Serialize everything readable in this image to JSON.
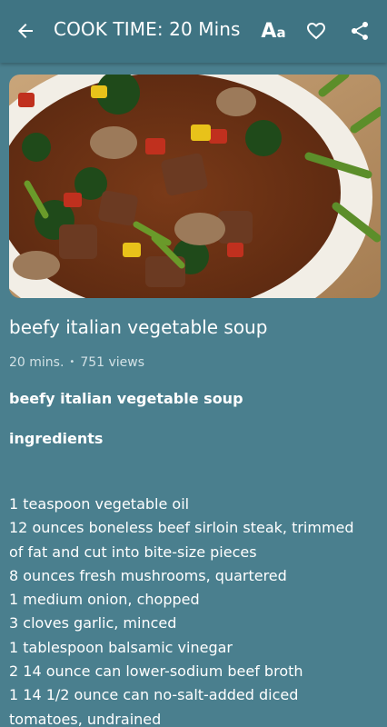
{
  "header": {
    "title": "COOK TIME: 20 Mins",
    "font_icon_big": "A",
    "font_icon_small": "a"
  },
  "recipe": {
    "title": "beefy italian vegetable soup",
    "cook_time": "20 mins.",
    "separator": "•",
    "views": "751 views",
    "subtitle": "beefy italian vegetable soup",
    "ingredients_heading": "ingredients",
    "ingredients": [
      "1 teaspoon vegetable oil",
      "12 ounces boneless beef sirloin steak, trimmed",
      "of fat and cut into bite-size pieces",
      "8 ounces fresh mushrooms, quartered",
      "1 medium onion, chopped",
      "3 cloves garlic, minced",
      "1 tablespoon balsamic vinegar",
      "2 14 ounce can lower-sodium beef broth",
      "1 14 1/2 ounce can no-salt-added diced",
      "tomatoes, undrained"
    ]
  },
  "colors": {
    "background": "#4a7f8e",
    "appbar": "#3f7483",
    "text": "#ffffff",
    "meta_text": "#d3e2e6"
  },
  "icons": [
    "back-arrow-icon",
    "font-size-icon",
    "heart-outline-icon",
    "share-icon"
  ]
}
